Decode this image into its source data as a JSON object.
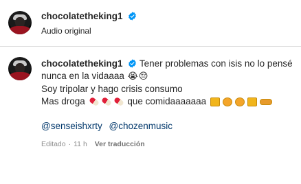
{
  "header": {
    "username": "chocolatetheking1",
    "subtitle": "Audio original"
  },
  "post": {
    "username": "chocolatetheking1",
    "line1": "Tener problemas con isis no lo pensé",
    "line2": "nunca en la vidaaaa",
    "line3": "Soy tripolar y hago crisis consumo",
    "line4a": "Mas droga",
    "line4b": "que comidaaaaaaa",
    "mentions": [
      "@senseishxrty",
      "@chozenmusic"
    ],
    "edited": "Editado",
    "time": "11 h",
    "translate": "Ver traducción"
  },
  "colors": {
    "verified": "#0095f6",
    "mention": "#00376b",
    "meta": "#8e8e8e"
  }
}
